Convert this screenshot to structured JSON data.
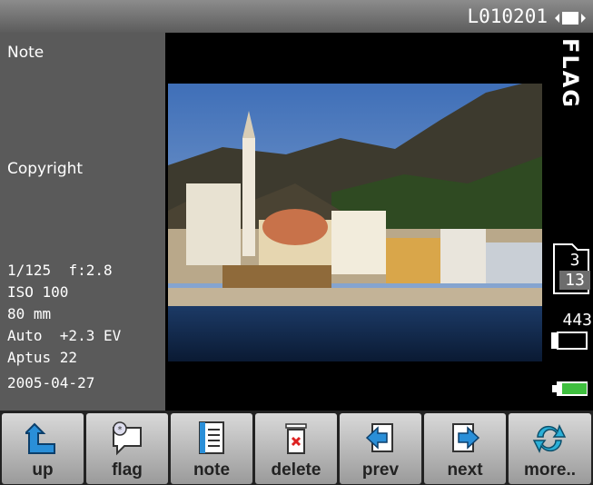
{
  "header": {
    "filename": "L010201"
  },
  "side_panel": {
    "note_label": "Note",
    "copyright_label": "Copyright",
    "exposure": {
      "shutter": "1/125",
      "aperture": "f:2.8"
    },
    "iso": "ISO 100",
    "focal_length": "80 mm",
    "mode": "Auto",
    "ev": "+2.3 EV",
    "back": "Aptus 22",
    "date": "2005-04-27"
  },
  "right_column": {
    "flag_label": "FLAG",
    "folder_current": "3",
    "folder_total": "13",
    "shots_left": "443"
  },
  "toolbar": {
    "buttons": [
      {
        "label": "up",
        "icon": "up-arrow-icon"
      },
      {
        "label": "flag",
        "icon": "flag-icon"
      },
      {
        "label": "note",
        "icon": "note-icon"
      },
      {
        "label": "delete",
        "icon": "trash-icon"
      },
      {
        "label": "prev",
        "icon": "prev-icon"
      },
      {
        "label": "next",
        "icon": "next-icon"
      },
      {
        "label": "more..",
        "icon": "refresh-icon"
      }
    ]
  },
  "colors": {
    "icon_blue": "#2a8fd8",
    "battery_green": "#3fbf3f"
  }
}
